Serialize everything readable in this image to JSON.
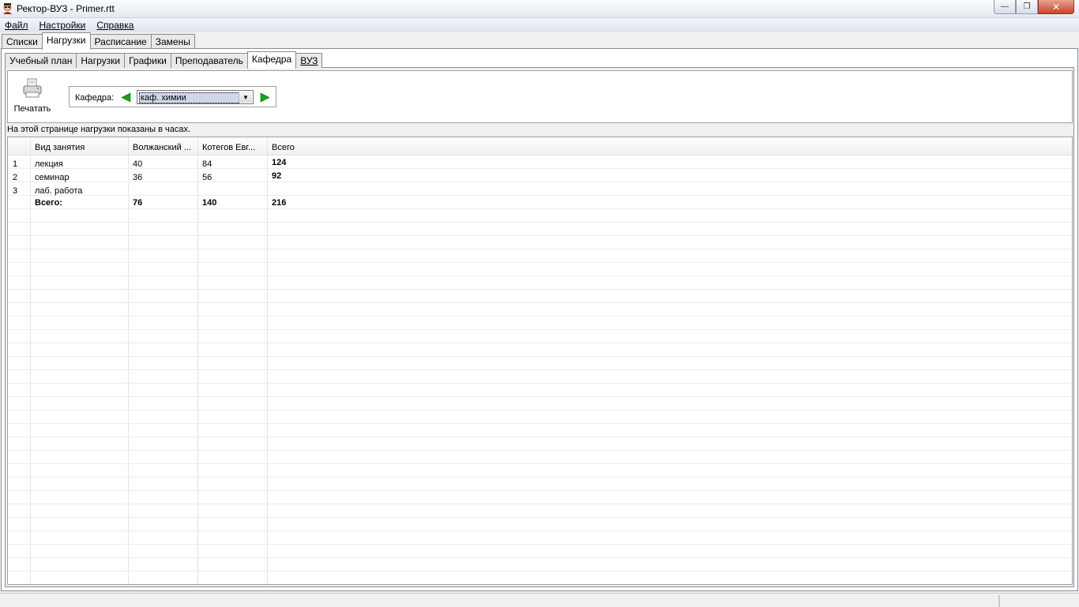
{
  "window": {
    "title": "Ректор-ВУЗ - Primer.rtt",
    "minimize": "—",
    "maximize": "❐",
    "close": "✕"
  },
  "menu": [
    "Файл",
    "Настройки",
    "Справка"
  ],
  "top_tabs": [
    {
      "label": "Списки",
      "active": false
    },
    {
      "label": "Нагрузки",
      "active": true
    },
    {
      "label": "Расписание",
      "active": false
    },
    {
      "label": "Замены",
      "active": false
    }
  ],
  "inner_tabs": [
    {
      "label": "Учебный план",
      "active": false
    },
    {
      "label": "Нагрузки",
      "active": false
    },
    {
      "label": "Графики",
      "active": false
    },
    {
      "label": "Преподаватель",
      "active": false
    },
    {
      "label": "Кафедра",
      "active": true
    },
    {
      "label": "ВУЗ",
      "active": false
    }
  ],
  "toolbar": {
    "print_label": "Печатать",
    "dept_label": "Кафедра:",
    "dept_value": "каф. химии"
  },
  "info_text": "На этой странице нагрузки показаны в часах.",
  "grid": {
    "columns": [
      "",
      "Вид занятия",
      "Волжанский ...",
      "Котегов Евг...",
      "Всего"
    ],
    "rows": [
      {
        "num": "1",
        "type": "лекция",
        "c1": "40",
        "c2": "84",
        "total": "124"
      },
      {
        "num": "2",
        "type": "семинар",
        "c1": "36",
        "c2": "56",
        "total": "92"
      },
      {
        "num": "3",
        "type": "лаб. работа",
        "c1": "",
        "c2": "",
        "total": ""
      },
      {
        "num": "",
        "type": "Всего:",
        "c1": "76",
        "c2": "140",
        "total": "216"
      }
    ]
  },
  "colors": {
    "arrow": "#1aa01a",
    "close_button": "#c7432a"
  }
}
